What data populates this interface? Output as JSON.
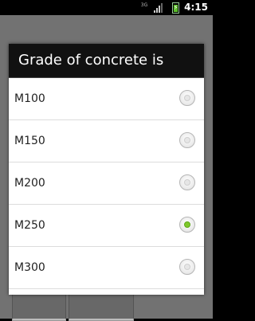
{
  "status_bar": {
    "network": "3G",
    "time": "4:15"
  },
  "dialog": {
    "title": "Grade of concrete is",
    "options": [
      {
        "label": "M100",
        "selected": false
      },
      {
        "label": "M150",
        "selected": false
      },
      {
        "label": "M200",
        "selected": false
      },
      {
        "label": "M250",
        "selected": true
      },
      {
        "label": "M300",
        "selected": false
      }
    ]
  },
  "colors": {
    "selected_radio": "#7ec82a",
    "dialog_title_bg": "#111111"
  }
}
